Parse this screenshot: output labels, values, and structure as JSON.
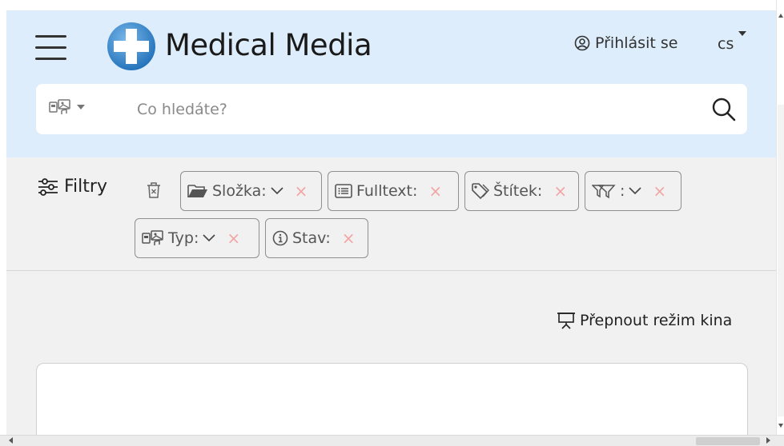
{
  "header": {
    "brand": "Medical Media",
    "login_label": "Přihlásit se",
    "language": "cs",
    "background_color": "#ddedfb",
    "logo_icon": "medical-cross-logo",
    "menu_icon": "hamburger-menu-icon"
  },
  "search": {
    "placeholder": "Co hledáte?",
    "value": "",
    "type_icon": "media-type-icon",
    "button_icon": "search-icon"
  },
  "filters": {
    "label": "Filtry",
    "clear_icon": "trash-icon",
    "chips": [
      {
        "icon": "folder-open-icon",
        "label": "Složka:",
        "has_dropdown": true
      },
      {
        "icon": "list-icon",
        "label": "Fulltext:",
        "has_dropdown": false
      },
      {
        "icon": "tag-icon",
        "label": "Štítek:",
        "has_dropdown": false
      },
      {
        "icon": "filter-outline-icon",
        "label": ":",
        "has_dropdown": true
      },
      {
        "icon": "media-type-icon",
        "label": "Typ:",
        "has_dropdown": true
      },
      {
        "icon": "info-icon",
        "label": "Stav:",
        "has_dropdown": false
      }
    ],
    "remove_symbol": "×",
    "remove_color": "#f2a5a5"
  },
  "main": {
    "cinema_mode_label": "Přepnout režim kina",
    "cinema_icon": "projector-screen-icon"
  }
}
